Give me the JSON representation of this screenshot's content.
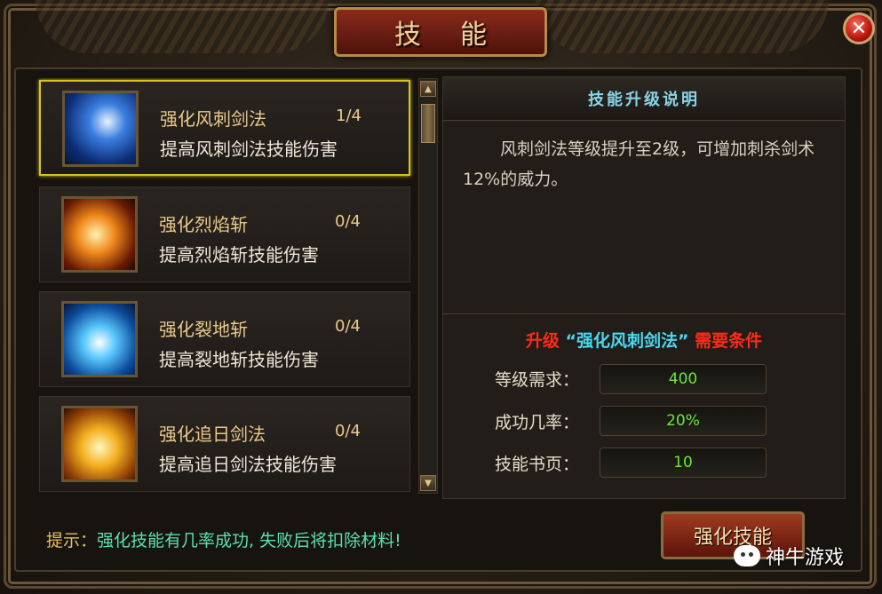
{
  "window": {
    "title": "技能"
  },
  "close_icon": "✕",
  "skills": [
    {
      "name": "强化风刺剑法",
      "level": "1/4",
      "desc": "提高风刺剑法技能伤害",
      "icon": "wind-sword-icon",
      "selected": true
    },
    {
      "name": "强化烈焰斩",
      "level": "0/4",
      "desc": "提高烈焰斩技能伤害",
      "icon": "flame-slash-icon",
      "selected": false
    },
    {
      "name": "强化裂地斩",
      "level": "0/4",
      "desc": "提高裂地斩技能伤害",
      "icon": "ground-split-icon",
      "selected": false
    },
    {
      "name": "强化追日剑法",
      "level": "0/4",
      "desc": "提高追日剑法技能伤害",
      "icon": "sun-chase-sword-icon",
      "selected": false
    }
  ],
  "detail": {
    "header": "技能升级说明",
    "description": "风刺剑法等级提升至2级，可增加刺杀剑术 12%的威力。",
    "condition_prefix": "升级",
    "condition_skill": "“强化风刺剑法”",
    "condition_suffix": "需要条件",
    "rows": [
      {
        "label": "等级需求：",
        "value": "400"
      },
      {
        "label": "成功几率：",
        "value": "20%"
      },
      {
        "label": "技能书页：",
        "value": "10"
      }
    ]
  },
  "hint": {
    "label": "提示：",
    "text": "强化技能有几率成功, 失败后将扣除材料!"
  },
  "upgrade_button": "强化技能",
  "watermark": "神牛游戏",
  "colors": {
    "selected_border": "#d8c21c",
    "value_green": "#6ae838",
    "condition_red": "#ff2a1a",
    "condition_cyan": "#4ad8f0"
  }
}
